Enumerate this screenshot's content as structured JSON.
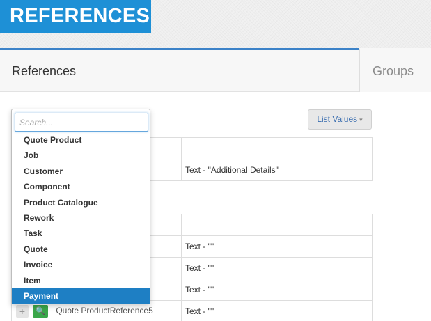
{
  "header": {
    "title": "REFERENCES"
  },
  "tabs": [
    {
      "label": "References",
      "active": true
    },
    {
      "label": "Groups",
      "active": false
    }
  ],
  "toolbar": {
    "list_values_label": "List Values",
    "caret": "▾"
  },
  "dropdown": {
    "search_placeholder": "Search...",
    "options": [
      "Quote Product",
      "Job",
      "Customer",
      "Component",
      "Product Catalogue",
      "Rework",
      "Task",
      "Quote",
      "Invoice",
      "Item",
      "Payment"
    ],
    "selected": "Payment"
  },
  "table_top": {
    "rows": [
      {
        "value": ""
      },
      {
        "value": "Text - \"Additional Details\""
      }
    ]
  },
  "table_bottom": {
    "rows": [
      {
        "value": ""
      },
      {
        "value": "Text - \"\""
      },
      {
        "value": "Text - \"\""
      },
      {
        "value": "Text - \"\""
      },
      {
        "name": "Quote ProductReference5",
        "value": "Text - \"\""
      }
    ]
  },
  "colors": {
    "accent": "#1e90d6",
    "selected": "#1e7fc4",
    "tab_border": "#3c82c8",
    "view_button": "#3aa64a"
  },
  "icons": {
    "add": "plus-icon",
    "view": "search-icon"
  }
}
